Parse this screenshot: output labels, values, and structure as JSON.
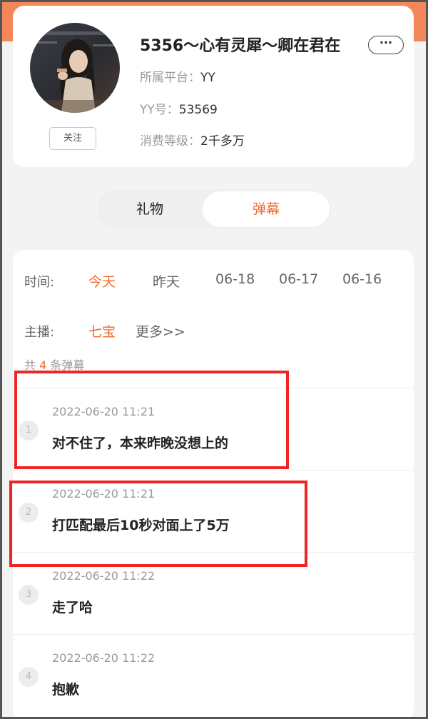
{
  "profile": {
    "name": "5356～心有灵犀～卿在君在",
    "more_label": "···",
    "follow_label": "关注",
    "platform_key": "所属平台：",
    "platform_value": "YY",
    "yy_key": "YY号：",
    "yy_value": "53569",
    "level_key": "消费等级：",
    "level_value": "2千多万"
  },
  "tabs": [
    {
      "label": "礼物",
      "active": false
    },
    {
      "label": "弹幕",
      "active": true
    }
  ],
  "filters": {
    "time_label": "时间:",
    "time_options": [
      "今天",
      "昨天",
      "06-18",
      "06-17",
      "06-16"
    ],
    "anchor_label": "主播:",
    "anchor_options": [
      "七宝",
      "更多>>"
    ]
  },
  "summary": {
    "prefix": "共",
    "count": "4",
    "suffix": "条弹幕"
  },
  "danmu": [
    {
      "index": "1",
      "time": "2022-06-20 11:21",
      "text": "对不住了，本来昨晚没想上的",
      "highlighted": true
    },
    {
      "index": "2",
      "time": "2022-06-20 11:21",
      "text": "打匹配最后10秒对面上了5万",
      "highlighted": true
    },
    {
      "index": "3",
      "time": "2022-06-20 11:22",
      "text": "走了哈",
      "highlighted": false
    },
    {
      "index": "4",
      "time": "2022-06-20 11:22",
      "text": "抱歉",
      "highlighted": false
    }
  ],
  "colors": {
    "accent": "#f06b2d",
    "banner": "#f4875a",
    "highlight_box": "#ef2424"
  }
}
